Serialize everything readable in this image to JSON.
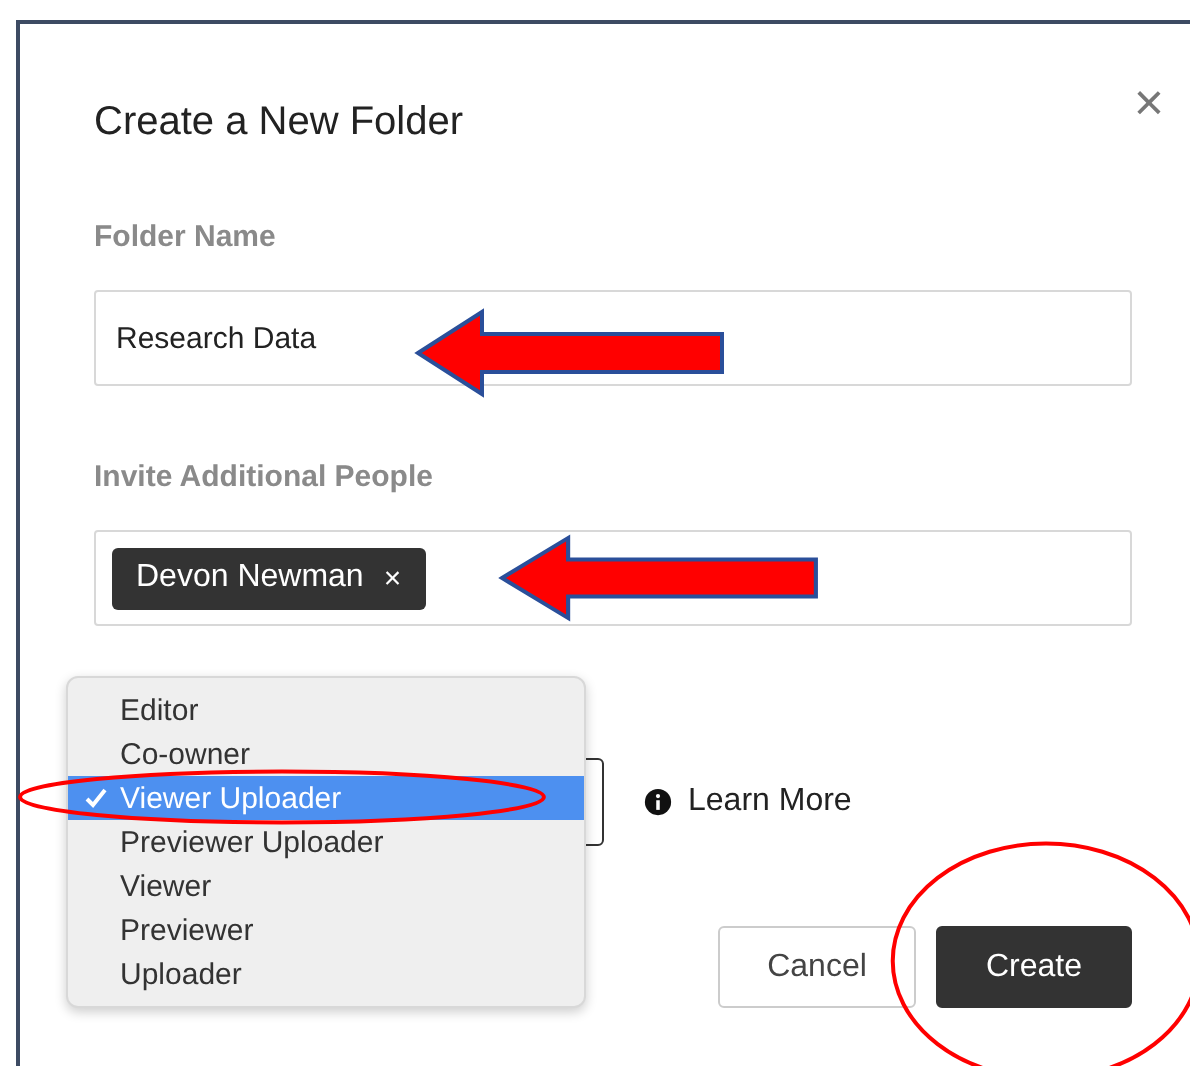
{
  "dialog": {
    "title": "Create a New Folder",
    "close": "×",
    "folder_name": {
      "label": "Folder Name",
      "value": "Research Data"
    },
    "invite": {
      "label": "Invite Additional People",
      "chips": [
        {
          "name": "Devon Newman",
          "remove": "×"
        }
      ]
    },
    "role_menu": {
      "items": [
        {
          "label": "Editor",
          "selected": false
        },
        {
          "label": "Co-owner",
          "selected": false
        },
        {
          "label": "Viewer Uploader",
          "selected": true
        },
        {
          "label": "Previewer Uploader",
          "selected": false
        },
        {
          "label": "Viewer",
          "selected": false
        },
        {
          "label": "Previewer",
          "selected": false
        },
        {
          "label": "Uploader",
          "selected": false
        }
      ]
    },
    "learn_more": "Learn More",
    "buttons": [
      {
        "label": "Cancel",
        "kind": "secondary"
      },
      {
        "label": "Create",
        "kind": "primary"
      }
    ]
  },
  "annotations": [
    {
      "kind": "arrow"
    },
    {
      "kind": "arrow"
    },
    {
      "kind": "ellipse"
    },
    {
      "kind": "ellipse"
    }
  ]
}
